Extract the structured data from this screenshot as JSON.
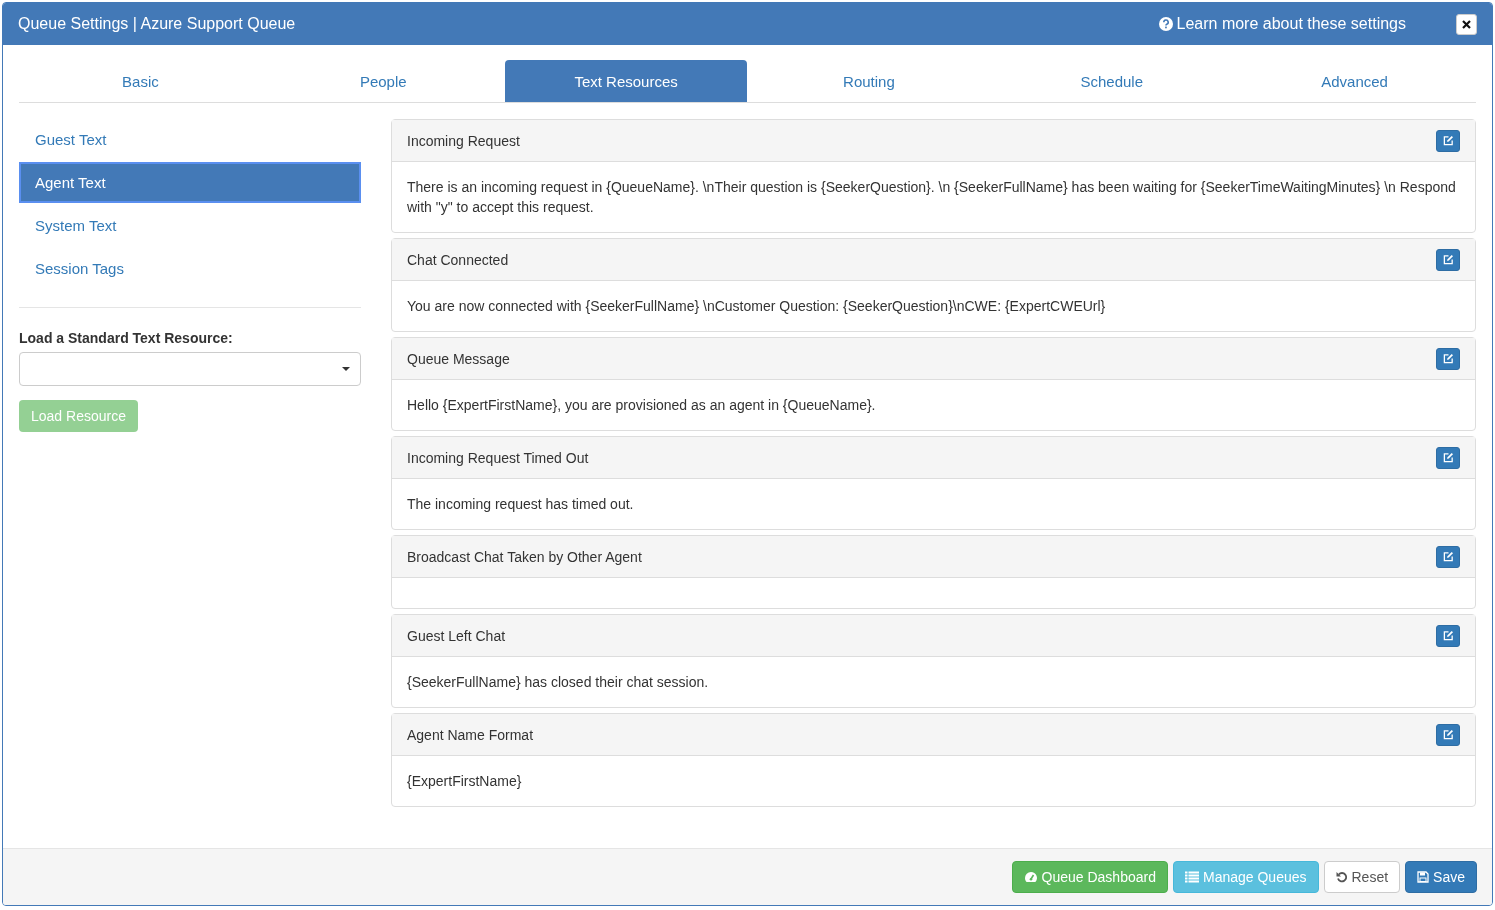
{
  "window": {
    "title": "Queue Settings | Azure Support Queue",
    "help_link": "Learn more about these settings"
  },
  "tabs": [
    {
      "label": "Basic",
      "selected": false
    },
    {
      "label": "People",
      "selected": false
    },
    {
      "label": "Text Resources",
      "selected": true
    },
    {
      "label": "Routing",
      "selected": false
    },
    {
      "label": "Schedule",
      "selected": false
    },
    {
      "label": "Advanced",
      "selected": false
    }
  ],
  "sidebar": {
    "items": [
      {
        "label": "Guest Text",
        "selected": false
      },
      {
        "label": "Agent Text",
        "selected": true
      },
      {
        "label": "System Text",
        "selected": false
      },
      {
        "label": "Session Tags",
        "selected": false
      }
    ],
    "load_label": "Load a Standard Text Resource:",
    "load_button": {
      "label": "Load Resource",
      "disabled": true
    }
  },
  "resources": [
    {
      "title": "Incoming Request",
      "text": "There is an incoming request in {QueueName}. \\nTheir question is {SeekerQuestion}. \\n {SeekerFullName} has been waiting for {SeekerTimeWaitingMinutes} \\n Respond with \"y\" to accept this request."
    },
    {
      "title": "Chat Connected",
      "text": "You are now connected with {SeekerFullName} \\nCustomer Question: {SeekerQuestion}\\nCWE: {ExpertCWEUrl}"
    },
    {
      "title": "Queue Message",
      "text": "Hello {ExpertFirstName}, you are provisioned as an agent in {QueueName}."
    },
    {
      "title": "Incoming Request Timed Out",
      "text": "The incoming request has timed out."
    },
    {
      "title": "Broadcast Chat Taken by Other Agent"
    },
    {
      "title": "Guest Left Chat",
      "text": "{SeekerFullName} has closed their chat session."
    },
    {
      "title": "Agent Name Format",
      "text": "{ExpertFirstName}"
    }
  ],
  "footer_buttons": [
    {
      "label": "Queue Dashboard",
      "kind": "dashboard"
    },
    {
      "label": "Manage Queues",
      "kind": "manage"
    },
    {
      "label": "Reset",
      "kind": "reset"
    },
    {
      "label": "Save",
      "kind": "save"
    }
  ]
}
